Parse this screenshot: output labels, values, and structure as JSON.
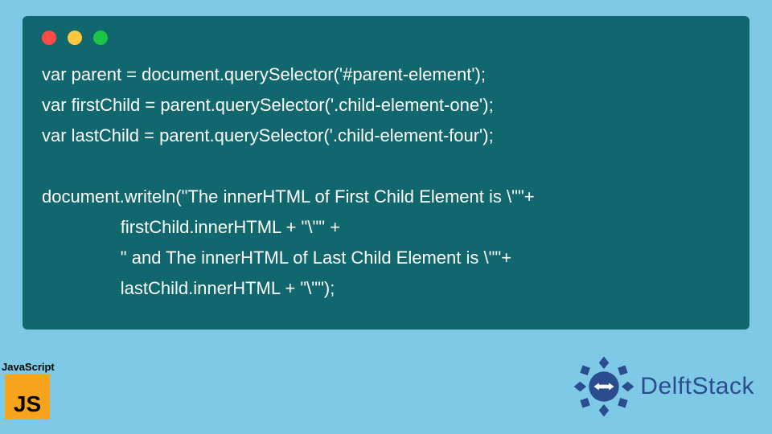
{
  "window": {
    "dots": [
      "red",
      "yellow",
      "green"
    ]
  },
  "code": {
    "line1": "var parent = document.querySelector('#parent-element');",
    "line2": "var firstChild = parent.querySelector('.child-element-one');",
    "line3": "var lastChild = parent.querySelector('.child-element-four');",
    "line4": "",
    "line5": "document.writeln(\"The innerHTML of First Child Element is \\\"\"+",
    "line6": "                firstChild.innerHTML + \"\\\"\" +",
    "line7": "                \" and The innerHTML of Last Child Element is \\\"\"+",
    "line8": "                lastChild.innerHTML + \"\\\"\");"
  },
  "badges": {
    "js_label": "JavaScript",
    "js_logo_text": "JS",
    "brand_name": "DelftStack"
  },
  "colors": {
    "page_bg": "#7ecae6",
    "window_bg": "#10686e",
    "code_text": "#ffffff",
    "js_logo_bg": "#f7a41d",
    "brand_color": "#2a4d8f"
  }
}
